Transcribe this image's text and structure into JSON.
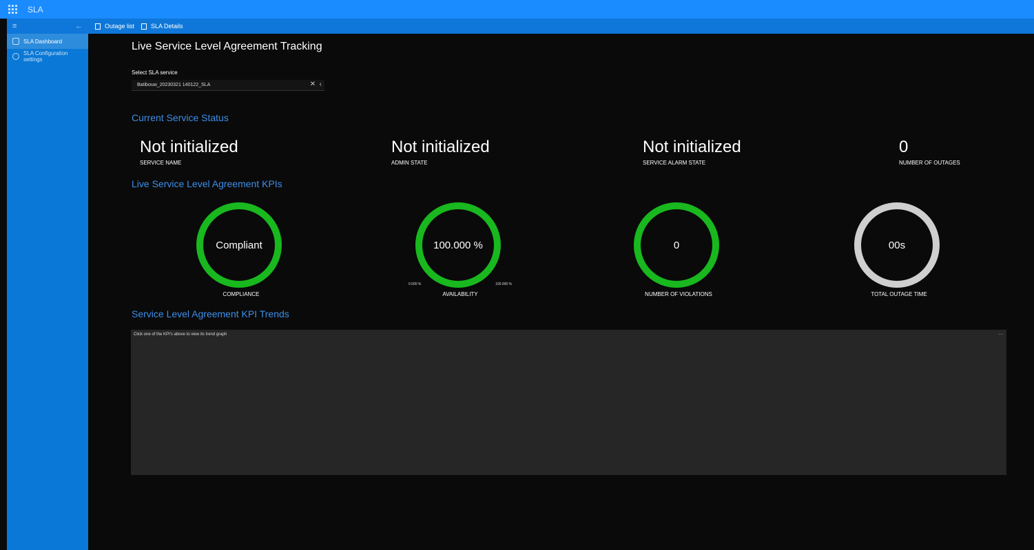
{
  "app": {
    "title": "SLA"
  },
  "nav": {
    "tabs": [
      {
        "label": "Outage list"
      },
      {
        "label": "SLA Details"
      }
    ]
  },
  "sidebar": {
    "items": [
      {
        "label": "SLA Dashboard"
      },
      {
        "label": "SLA Configuration settings"
      }
    ]
  },
  "main": {
    "title": "Live Service Level Agreement Tracking",
    "select_label": "Select SLA service",
    "select_value": "Batibouw_20230321 140122_SLA",
    "sections": {
      "status": "Current Service Status",
      "kpis": "Live Service Level Agreement KPIs",
      "trends": "Service Level Agreement KPI Trends"
    },
    "status": [
      {
        "value": "Not initialized",
        "label": "SERVICE NAME"
      },
      {
        "value": "Not initialized",
        "label": "ADMIN STATE"
      },
      {
        "value": "Not initialized",
        "label": "SERVICE ALARM STATE"
      },
      {
        "value": "0",
        "label": "NUMBER OF OUTAGES"
      }
    ],
    "kpis": [
      {
        "value": "Compliant",
        "label": "COMPLIANCE"
      },
      {
        "value": "100.000 %",
        "label": "AVAILABILITY",
        "min": "0.000 %",
        "max": "100.000 %"
      },
      {
        "value": "0",
        "label": "NUMBER OF VIOLATIONS"
      },
      {
        "value": "00s",
        "label": "TOTAL OUTAGE TIME"
      }
    ],
    "trend_hint": "Click one of the KPI's above to view its trend graph",
    "more": "···"
  },
  "colors": {
    "topbar": "#1a8cff",
    "sidebar": "#0a78d6",
    "accent": "#3d8ee8",
    "gauge_ok": "#18b81e",
    "gauge_neutral": "#cfcfcf"
  }
}
